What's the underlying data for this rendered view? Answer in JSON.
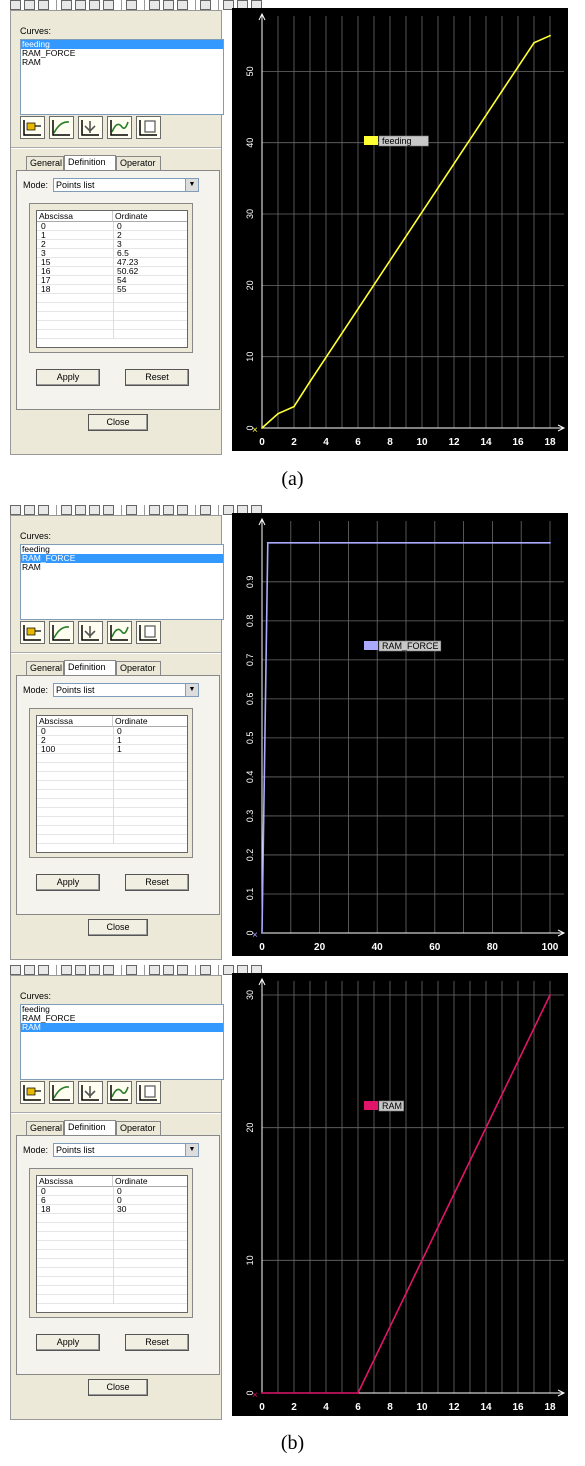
{
  "panels": [
    {
      "curves_label": "Curves:",
      "curves": [
        "feeding",
        "RAM_FORCE",
        "RAM"
      ],
      "selected_index": 0,
      "tabs": [
        "General",
        "Definition",
        "Operator"
      ],
      "active_tab": 1,
      "mode_label": "Mode:",
      "mode_value": "Points list",
      "columns": [
        "Abscissa",
        "Ordinate"
      ],
      "rows": [
        [
          "0",
          "0"
        ],
        [
          "1",
          "2"
        ],
        [
          "2",
          "3"
        ],
        [
          "3",
          "6.5"
        ],
        [
          "15",
          "47.23"
        ],
        [
          "16",
          "50.62"
        ],
        [
          "17",
          "54"
        ],
        [
          "18",
          "55"
        ]
      ],
      "apply_label": "Apply",
      "reset_label": "Reset",
      "close_label": "Close",
      "plot": {
        "legend": "feeding",
        "color": "#ffff33",
        "x_ticks": [
          "0",
          "2",
          "4",
          "6",
          "8",
          "10",
          "12",
          "14",
          "16",
          "18"
        ],
        "y_ticks": [
          "0",
          "10",
          "20",
          "30",
          "40",
          "50"
        ]
      }
    },
    {
      "curves_label": "Curves:",
      "curves": [
        "feeding",
        "RAM_FORCE",
        "RAM"
      ],
      "selected_index": 1,
      "tabs": [
        "General",
        "Definition",
        "Operator"
      ],
      "active_tab": 1,
      "mode_label": "Mode:",
      "mode_value": "Points list",
      "columns": [
        "Abscissa",
        "Ordinate"
      ],
      "rows": [
        [
          "0",
          "0"
        ],
        [
          "2",
          "1"
        ],
        [
          "100",
          "1"
        ]
      ],
      "apply_label": "Apply",
      "reset_label": "Reset",
      "close_label": "Close",
      "plot": {
        "legend": "RAM_FORCE",
        "color": "#aaaaff",
        "x_ticks": [
          "0",
          "20",
          "40",
          "60",
          "80",
          "100"
        ],
        "y_ticks": [
          "0",
          "0.1",
          "0.2",
          "0.3",
          "0.4",
          "0.5",
          "0.6",
          "0.7",
          "0.8",
          "0.9"
        ]
      }
    },
    {
      "curves_label": "Curves:",
      "curves": [
        "feeding",
        "RAM_FORCE",
        "RAM"
      ],
      "selected_index": 2,
      "tabs": [
        "General",
        "Definition",
        "Operator"
      ],
      "active_tab": 1,
      "mode_label": "Mode:",
      "mode_value": "Points list",
      "columns": [
        "Abscissa",
        "Ordinate"
      ],
      "rows": [
        [
          "0",
          "0"
        ],
        [
          "6",
          "0"
        ],
        [
          "18",
          "30"
        ]
      ],
      "apply_label": "Apply",
      "reset_label": "Reset",
      "close_label": "Close",
      "plot": {
        "legend": "RAM",
        "color": "#e0156a",
        "x_ticks": [
          "0",
          "2",
          "4",
          "6",
          "8",
          "10",
          "12",
          "14",
          "16",
          "18"
        ],
        "y_ticks": [
          "0",
          "10",
          "20",
          "30"
        ]
      }
    }
  ],
  "captions": [
    "(a)",
    "(b)"
  ],
  "chart_data": [
    {
      "type": "line",
      "series": [
        {
          "name": "feeding",
          "x": [
            0,
            1,
            2,
            3,
            15,
            16,
            17,
            18
          ],
          "y": [
            0,
            2,
            3,
            6.5,
            47.23,
            50.62,
            54,
            55
          ]
        }
      ],
      "xlim": [
        0,
        18
      ],
      "ylim": [
        0,
        55
      ],
      "grid": true,
      "legend": "center"
    },
    {
      "type": "line",
      "series": [
        {
          "name": "RAM_FORCE",
          "x": [
            0,
            2,
            100
          ],
          "y": [
            0,
            1,
            1
          ]
        }
      ],
      "xlim": [
        0,
        100
      ],
      "ylim": [
        0,
        1
      ],
      "grid": true,
      "legend": "center"
    },
    {
      "type": "line",
      "series": [
        {
          "name": "RAM",
          "x": [
            0,
            6,
            18
          ],
          "y": [
            0,
            0,
            30
          ]
        }
      ],
      "xlim": [
        0,
        18
      ],
      "ylim": [
        0,
        30
      ],
      "grid": true,
      "legend": "center"
    }
  ]
}
